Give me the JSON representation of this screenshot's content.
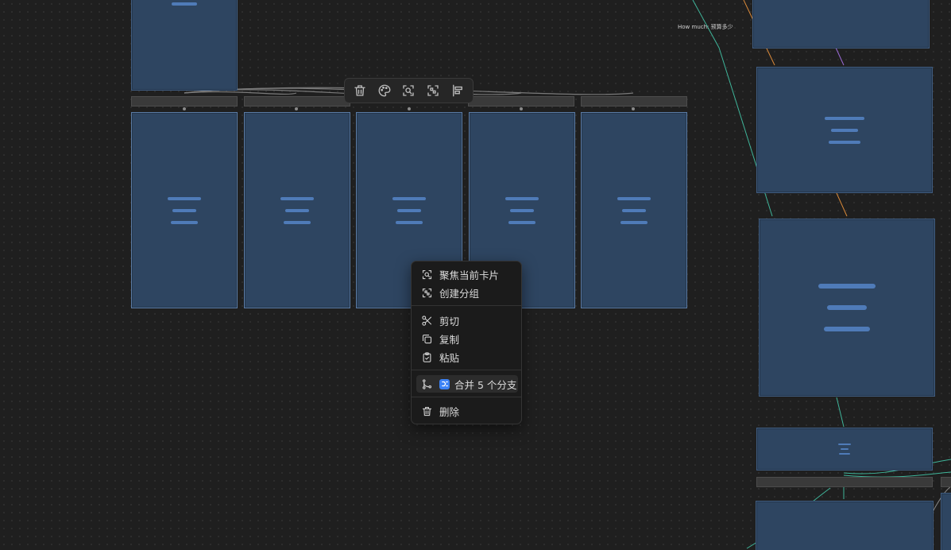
{
  "toolbar": {
    "icons": [
      "trash-icon",
      "palette-icon",
      "focus-icon",
      "group-icon",
      "align-icon"
    ]
  },
  "context_menu": {
    "focus_card": "聚焦当前卡片",
    "create_group": "创建分组",
    "cut": "剪切",
    "copy": "复制",
    "paste": "粘贴",
    "merge_branches": "合并 5 个分支",
    "delete": "删除"
  },
  "canvas": {
    "edge_label": "How much: 预算多少"
  },
  "colors": {
    "card_fill": "#2e4561",
    "card_border": "#3f5c80",
    "text_lines": "#4f7bb8",
    "edge_green": "#3fb59a",
    "edge_orange": "#d9893a",
    "edge_purple": "#9b6bd6",
    "merge_badge": "#3b82f6"
  }
}
